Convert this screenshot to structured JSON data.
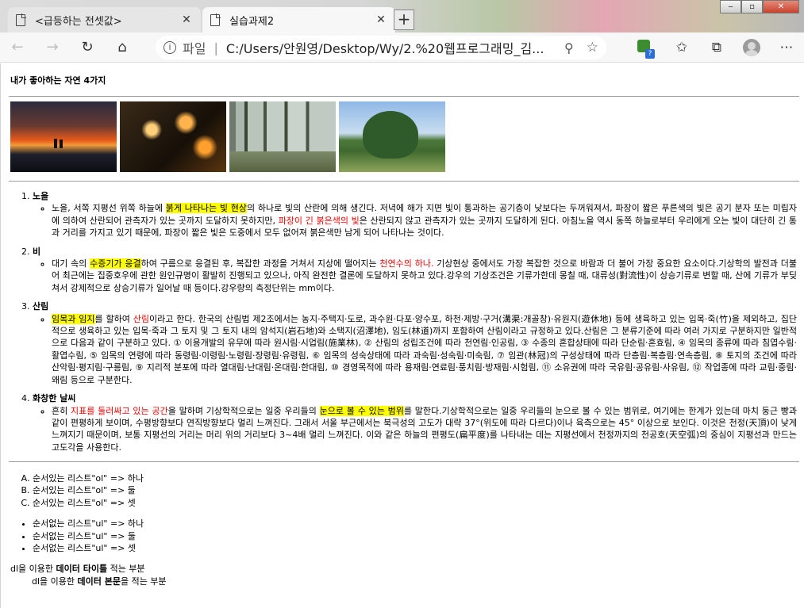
{
  "browser": {
    "tabs": [
      {
        "label": "<급등하는 전셋값>",
        "close": "✕"
      },
      {
        "label": "실습과제2",
        "close": "✕"
      }
    ],
    "new_tab": "+",
    "window_controls": {
      "minimize": "‒",
      "maximize": "▫",
      "close": "✕"
    },
    "nav": {
      "back": "←",
      "forward": "→",
      "refresh": "↻",
      "home": "⌂"
    },
    "address": {
      "info": "i",
      "scheme": "파일",
      "separator": "|",
      "url": "C:/Users/안원영/Desktop/Wy/2.%20웹프로그래밍_김...",
      "zoom_icon": "⚲",
      "favorite_icon": "☆"
    },
    "extension_badge": "?",
    "toolbar_icons": {
      "favorites": "✩",
      "collections": "⧉",
      "more": "⋯"
    }
  },
  "page": {
    "title": "내가 좋아하는 자연 4가지",
    "items": [
      {
        "heading": "노을",
        "segments": [
          {
            "t": "노을, 서쪽 지평선 위쪽 하늘에 ",
            "s": ""
          },
          {
            "t": "붉게 나타나는 빛 현상",
            "s": "hl"
          },
          {
            "t": "의 하나로 빛의 산란에 의해 생긴다. 저녁에 해가 지면 빛이 통과하는 공기층이 낮보다는 두꺼워져서, 파장이 짧은 푸른색의 빛은 공기 분자 또는 미립자에 의하여 산란되어 관측자가 있는 곳까지 도달하지 못하지만, ",
            "s": ""
          },
          {
            "t": "파장이 긴 붉은색의 빛",
            "s": "rd"
          },
          {
            "t": "은 산란되지 않고 관측자가 있는 곳까지 도달하게 된다. 아침노을 역시 동쪽 하늘로부터 우리에게 오는 빛이 대단히 긴 통과 거리를 가지고 있기 때문에, 파장이 짧은 빛은 도중에서 모두 없어져 붉은색만 남게 되어 나타나는 것이다.",
            "s": ""
          }
        ]
      },
      {
        "heading": "비",
        "segments": [
          {
            "t": "대기 속의 ",
            "s": ""
          },
          {
            "t": "수증기가 응결",
            "s": "hl"
          },
          {
            "t": "하여 구름으로 응결된 후, 복잡한 과정을 거쳐서 지상에 떨어지는 ",
            "s": ""
          },
          {
            "t": "천연수의 하나.",
            "s": "rd"
          },
          {
            "t": " 기상현상 중에서도 가장 복잡한 것으로 바람과 더 불어 가장 중요한 요소이다.기상학의 발전과 더불어 최근에는 집중호우에 관한 원인규명이 활발히 진행되고 있으나, 아직 완전한 결론에 도달하지 못하고 있다.강우의 기상조건은 기류가한데 몽칠 때, 대류성(對流性)이 상승기류로 변할 때, 산에 기류가 부딪쳐서 강제적으로 상승기류가 일어날 때 등이다.강우량의 측정단위는 mm이다.",
            "s": ""
          }
        ]
      },
      {
        "heading": "산림",
        "segments": [
          {
            "t": "임목과 임지",
            "s": "hl"
          },
          {
            "t": "를 할하여 ",
            "s": ""
          },
          {
            "t": "산림",
            "s": "rd"
          },
          {
            "t": "이라고 한다. 한국의 산림법 제2조에서는 농지·주택지·도로, 과수원·다포·양수포, 하천·제방·구거(溝渠:개골창)·유원지(遊休地) 등에 생육하고 있는 입목·죽(竹)을 제외하고, 집단적으로 생육하고 있는 입목·죽과 그 토지 및 그 토지 내의 암석지(岩石地)와 소택지(沼澤地), 임도(林道)까지 포함하여 산림이라고 규정하고 있다.산림은 그 분류기준에 따라 여러 가지로 구분하지만 일반적으로 다음과 같이 구분하고 있다. ① 이용개발의 유무에 따라 원시림·시업림(施業林), ② 산림의 성립조건에 따라 천연림·인공림, ③ 수종의 혼합상태에 따라 단순림·혼효림, ④ 임목의 종류에 따라 침엽수림·활엽수림, ⑤ 임목의 연령에 따라 동령림·이령림·노령림·장령림·유령림, ⑥ 임목의 성숙상태에 따라 과숙림·성숙림·미숙림, ⑦ 임관(林冠)의 구성상태에 따라 단층림·복층림·연속층림, ⑧ 토지의 조건에 따라 산악림·평지림·구릉림, ⑨ 지리적 분포에 따라 열대림·난대림·온대림·한대림, ⑩ 경영목적에 따라 용재림·연료림·풍치림·방재림·시험림, ⑪ 소유권에 따라 국유림·공유림·사유림, ⑫ 작업종에 따라 교림·중림·왜림 등으로 구분한다.",
            "s": ""
          }
        ]
      },
      {
        "heading": "화창한 날씨",
        "segments": [
          {
            "t": "흔히 ",
            "s": ""
          },
          {
            "t": "지표를 둘러싸고 있는 공간",
            "s": "rd"
          },
          {
            "t": "을 말하며 기상학적으로는 일중 우리들의 ",
            "s": ""
          },
          {
            "t": "눈으로 볼 수 있는 범위",
            "s": "hl"
          },
          {
            "t": "를 말한다.기상학적으로는 일중 우리들의 눈으로 볼 수 있는 범위로, 여기에는 한계가 있는데 마치 둥근 빵과 같이 편평하게 보이며, 수평방향보다 연직방향보다 멀리 느껴진다. 그래서 서울 부근에서는 북극성의 고도가 대략 37°(위도에 따라 다르다)이나 육측으로는 45° 이상으로 보인다. 이것은 천정(天頂)이 낮게 느껴지기 때문이며, 보통 지평선의 거리는 머리 위의 거리보다 3~4배 멀리 느껴진다. 이와 같은 하늘의 편평도(扁平度)를 나타내는 데는 지평선에서 천정까지의 천공호(天空弧)의 중심이 지평선과 만드는 고도각을 사용한다.",
            "s": ""
          }
        ]
      }
    ],
    "ordered_list": [
      "순서있는 리스트\"ol\" => 하나",
      "순서있는 리스트\"ol\" => 둘",
      "순서있는 리스트\"ol\" => 셋"
    ],
    "unordered_list": [
      "순서없는 리스트\"ul\" => 하나",
      "순서없는 리스트\"ul\" => 둘",
      "순서없는 리스트\"ul\" => 셋"
    ],
    "dl": {
      "dt_pre": "dl을 이용한 ",
      "dt_bold": "데이터 타이틀",
      "dt_post": " 적는 부분",
      "dd_pre": "dl을 이용한 ",
      "dd_bold": "데이터 본문",
      "dd_post": "을 적는 부분"
    }
  }
}
